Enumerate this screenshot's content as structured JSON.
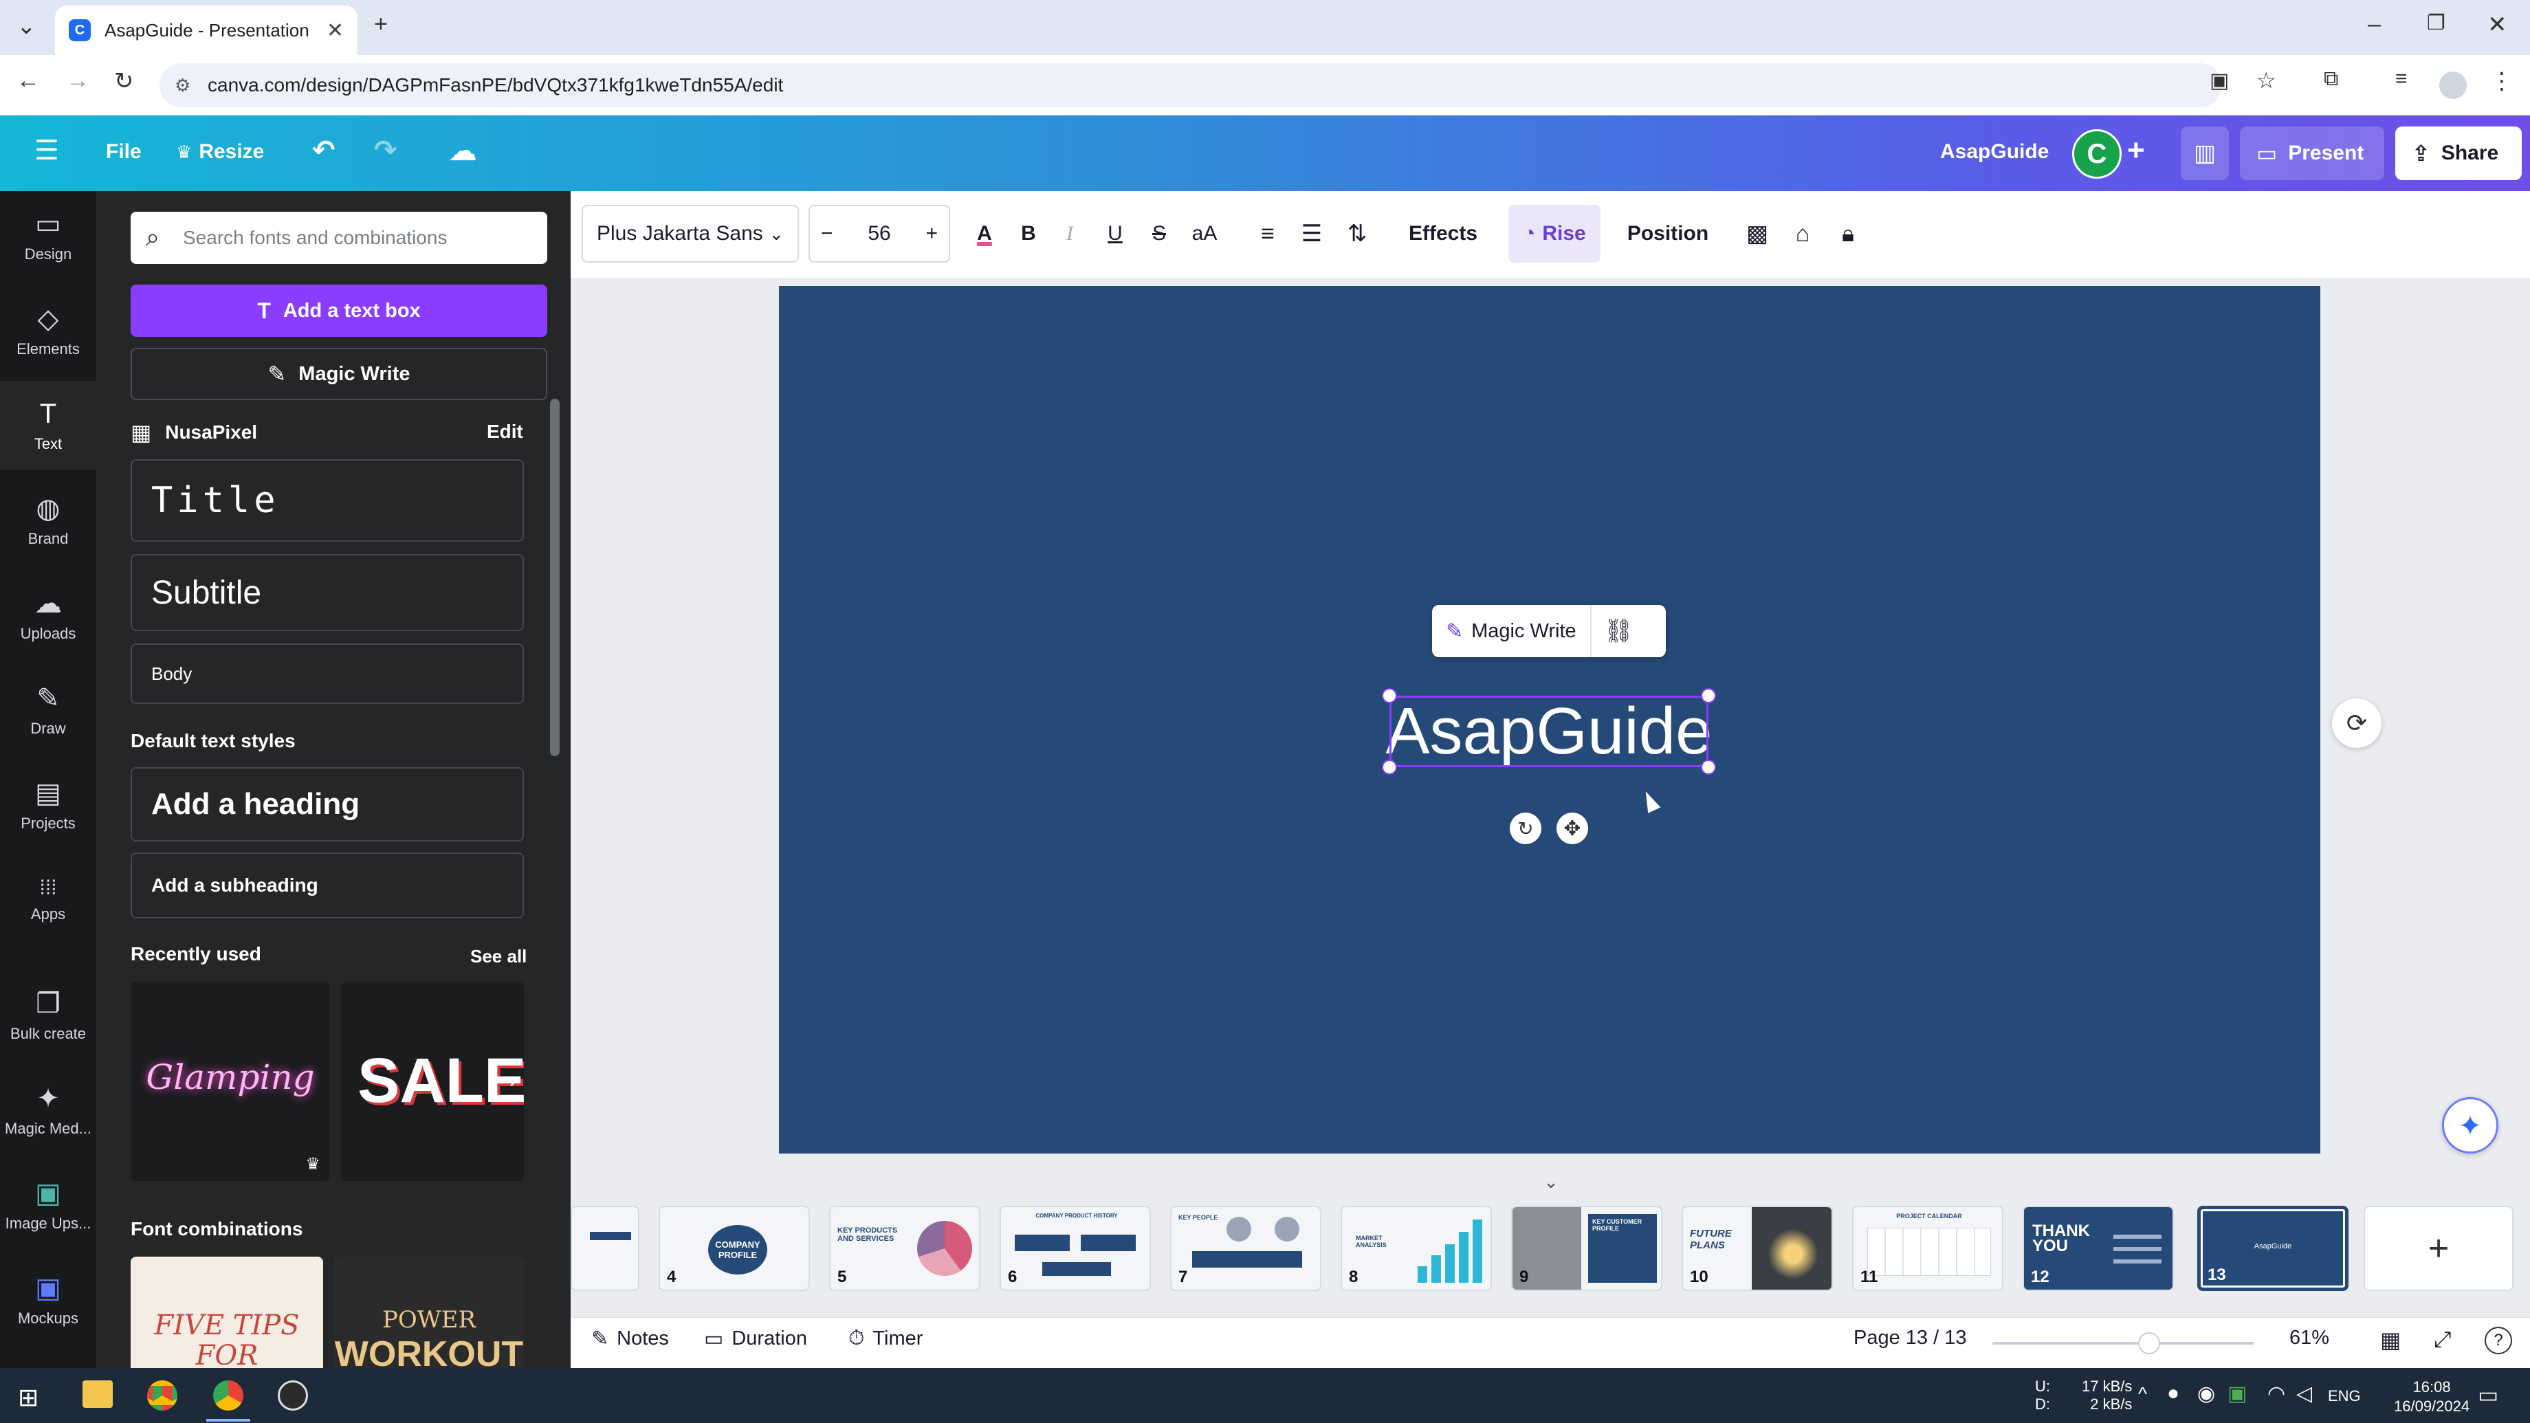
{
  "browser": {
    "tab_title": "AsapGuide - Presentation",
    "url": "canva.com/design/DAGPmFasnPE/bdVQtx371kfg1kweTdn55A/edit"
  },
  "header": {
    "file_label": "File",
    "resize_label": "Resize",
    "doc_name": "AsapGuide",
    "avatar_letter": "C",
    "present_label": "Present",
    "share_label": "Share"
  },
  "rail": {
    "items": [
      {
        "label": "Design",
        "icon": "▭"
      },
      {
        "label": "Elements",
        "icon": "◇"
      },
      {
        "label": "Text",
        "icon": "T"
      },
      {
        "label": "Brand",
        "icon": "◍"
      },
      {
        "label": "Uploads",
        "icon": "☁"
      },
      {
        "label": "Draw",
        "icon": "✎"
      },
      {
        "label": "Projects",
        "icon": "▤"
      },
      {
        "label": "Apps",
        "icon": "⁞⁞⁞"
      },
      {
        "label": "Bulk create",
        "icon": "❐"
      },
      {
        "label": "Magic Med...",
        "icon": "✦"
      },
      {
        "label": "Image Ups...",
        "icon": "▣"
      },
      {
        "label": "Mockups",
        "icon": "▣"
      }
    ]
  },
  "panel": {
    "search_placeholder": "Search fonts and combinations",
    "add_text_label": "Add a text box",
    "magic_write_label": "Magic Write",
    "brand_name": "NusaPixel",
    "edit_label": "Edit",
    "title_style": "Title",
    "subtitle_style": "Subtitle",
    "body_style": "Body",
    "default_styles_heading": "Default text styles",
    "add_heading": "Add a heading",
    "add_subheading": "Add a subheading",
    "recently_used": "Recently used",
    "see_all": "See all",
    "recent_1": "Glamping",
    "recent_2": "SALE",
    "font_combinations": "Font combinations",
    "combo_1": "FIVE TIPS FOR GREAT",
    "combo_2_top": "POWER",
    "combo_2_bottom": "WORKOUT"
  },
  "toolbar": {
    "font_name": "Plus Jakarta Sans",
    "font_size": "56",
    "effects_label": "Effects",
    "animation_label": "Rise",
    "position_label": "Position"
  },
  "canvas": {
    "slide_text": "AsapGuide",
    "magic_write_label": "Magic Write",
    "slide_bg": "#264a77"
  },
  "filmstrip": {
    "slides": [
      {
        "num": "4",
        "caption": "COMPANY PROFILE"
      },
      {
        "num": "5",
        "caption": "KEY PRODUCTS AND SERVICES"
      },
      {
        "num": "6",
        "caption": "COMPANY PRODUCT HISTORY"
      },
      {
        "num": "7",
        "caption": "KEY PEOPLE"
      },
      {
        "num": "8",
        "caption": "MARKET ANALYSIS"
      },
      {
        "num": "9",
        "caption": "KEY CUSTOMER PROFILE"
      },
      {
        "num": "10",
        "caption": "FUTURE PLANS"
      },
      {
        "num": "11",
        "caption": "PROJECT CALENDAR"
      },
      {
        "num": "12",
        "caption": "THANK YOU"
      },
      {
        "num": "13",
        "caption": "AsapGuide"
      }
    ]
  },
  "footer": {
    "notes_label": "Notes",
    "duration_label": "Duration",
    "timer_label": "Timer",
    "page_indicator": "Page 13 / 13",
    "zoom_level": "61%",
    "zoom_fraction": 0.61
  },
  "taskbar": {
    "net_up_label": "U:",
    "net_down_label": "D:",
    "net_up": "17 kB/s",
    "net_down": "2 kB/s",
    "lang": "ENG",
    "time": "16:08",
    "date": "16/09/2024"
  }
}
